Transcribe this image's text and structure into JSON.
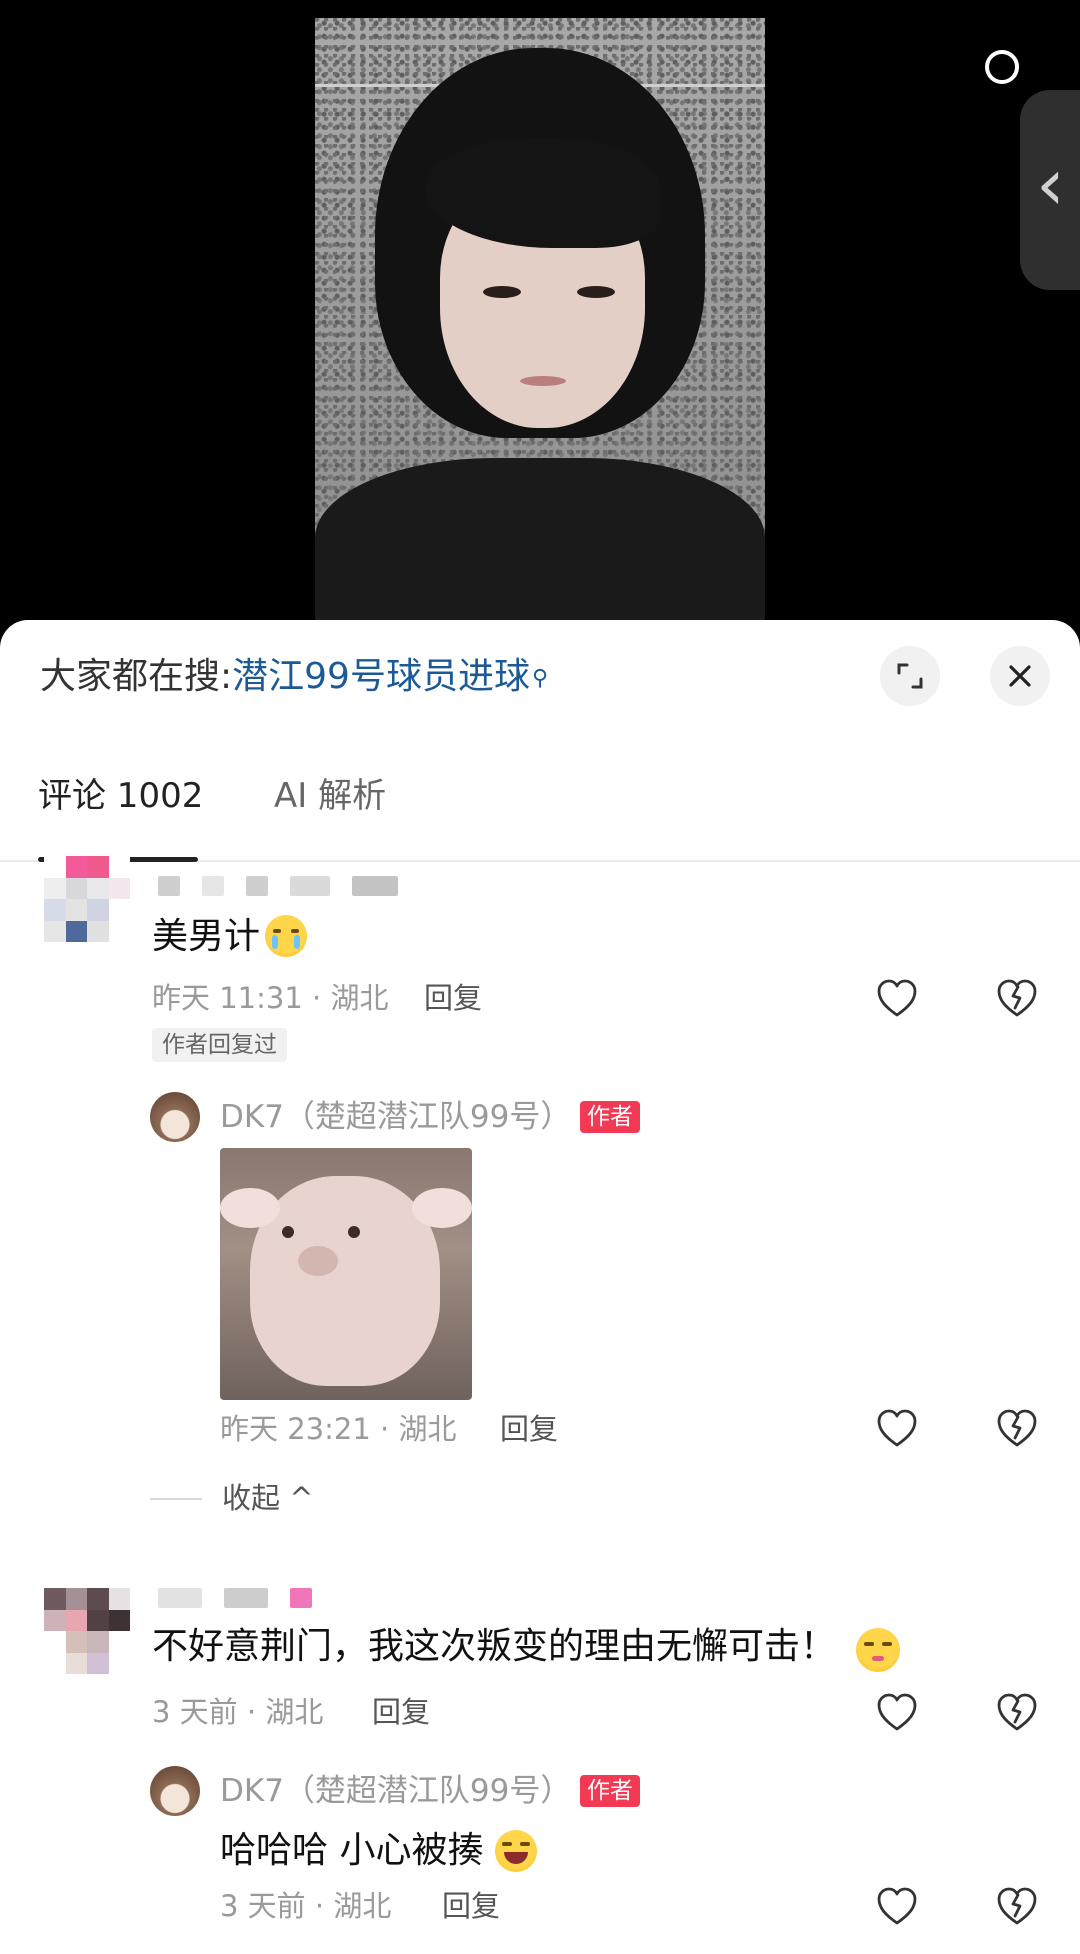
{
  "search": {
    "prefix": "大家都在搜:",
    "query": "潜江99号球员进球"
  },
  "tabs": [
    {
      "label": "评论 1002"
    },
    {
      "label": "AI 解析"
    }
  ],
  "comments": [
    {
      "text": "美男计",
      "time": "昨天 11:31 · 湖北",
      "reply_label": "回复",
      "badge": "作者回复过",
      "reply": {
        "name": "DK7（楚超潜江队99号）",
        "tag": "作者",
        "time": "昨天 23:21 · 湖北",
        "reply_label": "回复"
      },
      "collapse_label": "收起 ^"
    },
    {
      "text": "不好意荆门，我这次叛变的理由无懈可击！",
      "time": "3 天前 · 湖北",
      "reply_label": "回复",
      "reply": {
        "name": "DK7（楚超潜江队99号）",
        "tag": "作者",
        "text": "哈哈哈 小心被揍",
        "time": "3 天前 · 湖北",
        "reply_label": "回复"
      }
    }
  ],
  "icons": {
    "like": "heart-icon",
    "dislike": "broken-heart-icon",
    "expand": "expand-icon",
    "close": "close-icon",
    "drawer": "chevron-left-icon"
  },
  "colors": {
    "search_query": "#1b5a96",
    "author_tag": "#f23a55"
  }
}
